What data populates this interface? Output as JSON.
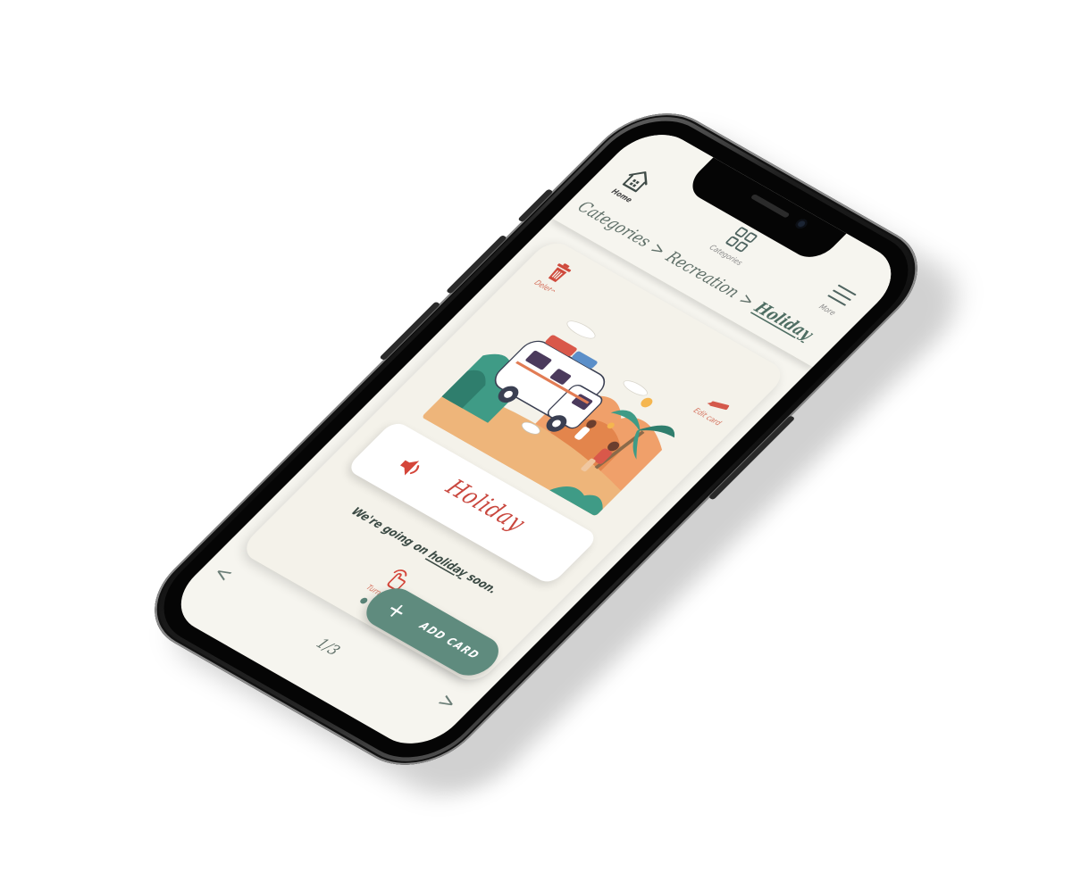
{
  "header": {
    "home_label": "Home",
    "categories_label": "Categories",
    "more_label": "More"
  },
  "breadcrumb": {
    "items": [
      "Categories",
      "Recreation",
      "Holiday"
    ],
    "separator": ">"
  },
  "card": {
    "delete_label": "Delete",
    "edit_label": "Edit card",
    "word": "Holiday",
    "sentence_before": "We're going on ",
    "sentence_keyword": "holiday",
    "sentence_after": " soon.",
    "turn_over_label": "Turn over",
    "dots_total": 2,
    "dots_active": 1
  },
  "footer": {
    "prev_glyph": "<",
    "next_glyph": ">",
    "page_indicator": "1/3",
    "add_card_plus": "+",
    "add_card_label": "ADD CARD"
  },
  "colors": {
    "accent": "#5f8b7e",
    "danger": "#c9473e",
    "screen_bg": "#f6f5ef",
    "text": "#5f6f68"
  },
  "icons": {
    "home": "home-icon",
    "categories": "grid-icon",
    "more": "hamburger-menu-icon",
    "delete": "trash-icon",
    "edit": "pencil-icon",
    "speaker": "speaker-icon",
    "turn_over": "tap-hand-icon"
  }
}
